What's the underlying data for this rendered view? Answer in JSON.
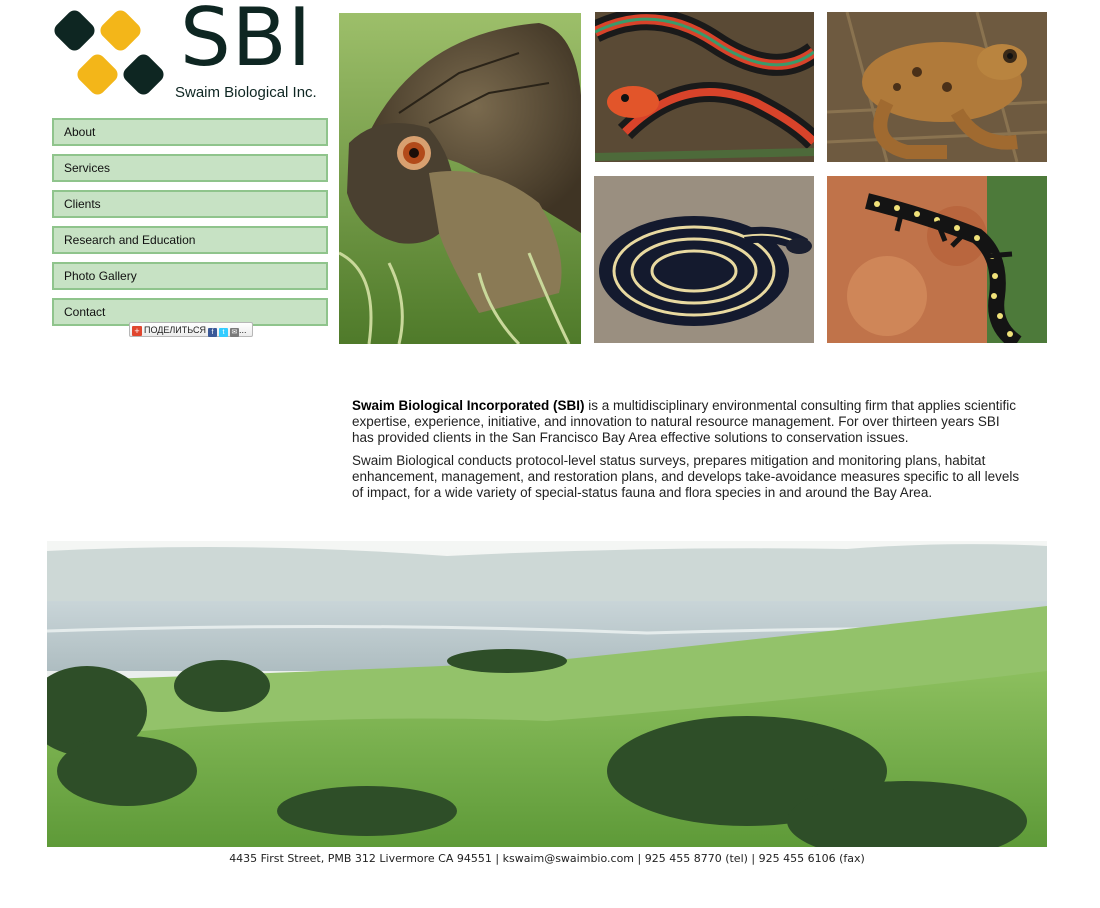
{
  "logo": {
    "letters": "SBI",
    "company": "Swaim Biological Inc.",
    "colors": {
      "diamond_dark": "#0e2622",
      "diamond_gold": "#f3b619"
    }
  },
  "nav": {
    "items": [
      {
        "label": "About"
      },
      {
        "label": "Services"
      },
      {
        "label": "Clients"
      },
      {
        "label": "Research and Education"
      },
      {
        "label": "Photo Gallery"
      },
      {
        "label": "Contact"
      }
    ],
    "colors": {
      "fill": "#c7e2c4",
      "border": "#8fc48c"
    }
  },
  "share": {
    "label": "ПОДЕЛИТЬСЯ",
    "more": "..."
  },
  "photos": {
    "turtle": "turtle-photo",
    "garter_snake": "garter-snake-photo",
    "frog": "frog-photo",
    "ring_snake": "striped-snake-photo",
    "salamander": "salamander-photo",
    "landscape": "bay-area-landscape-photo"
  },
  "intro": {
    "p1_company": "Swaim Biological Incorporated (SBI)",
    "p1_rest": " is a multidisciplinary environmental consulting firm that applies scientific expertise, experience, initiative, and innovation to natural resource management. For over thirteen years SBI has provided clients in the San Francisco Bay Area effective solutions to conservation issues.",
    "p2": "Swaim Biological conducts protocol-level status surveys, prepares mitigation and monitoring plans, habitat enhancement, management, and restoration plans, and develops take-avoidance measures specific to all levels of impact, for a wide variety of special-status fauna and flora species in and around the Bay Area."
  },
  "footer": {
    "address": "4435 First Street, PMB 312 Livermore CA 94551",
    "separator": " | ",
    "email": "kswaim@swaimbio.com",
    "tel": "925 455 8770 (tel)",
    "fax": "925 455 6106 (fax)"
  }
}
